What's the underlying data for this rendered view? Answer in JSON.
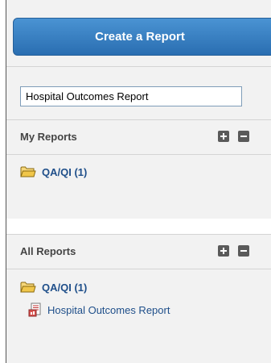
{
  "create_button": {
    "label": "Create a Report"
  },
  "report_name_input": {
    "value": "Hospital Outcomes Report"
  },
  "my_reports": {
    "title": "My Reports",
    "folders": [
      {
        "label": "QA/QI (1)"
      }
    ]
  },
  "all_reports": {
    "title": "All Reports",
    "folders": [
      {
        "label": "QA/QI (1)"
      }
    ],
    "reports": [
      {
        "label": "Hospital Outcomes Report"
      }
    ]
  },
  "colors": {
    "button_top": "#4a93d3",
    "button_bottom": "#2a6eb1",
    "link": "#1f4f8a",
    "panel_bg": "#f2f2f2",
    "folder": "#f0c64a"
  },
  "icons": {
    "expand": "plus-icon",
    "collapse": "minus-icon",
    "folder": "folder-open-icon",
    "report": "report-document-icon"
  }
}
